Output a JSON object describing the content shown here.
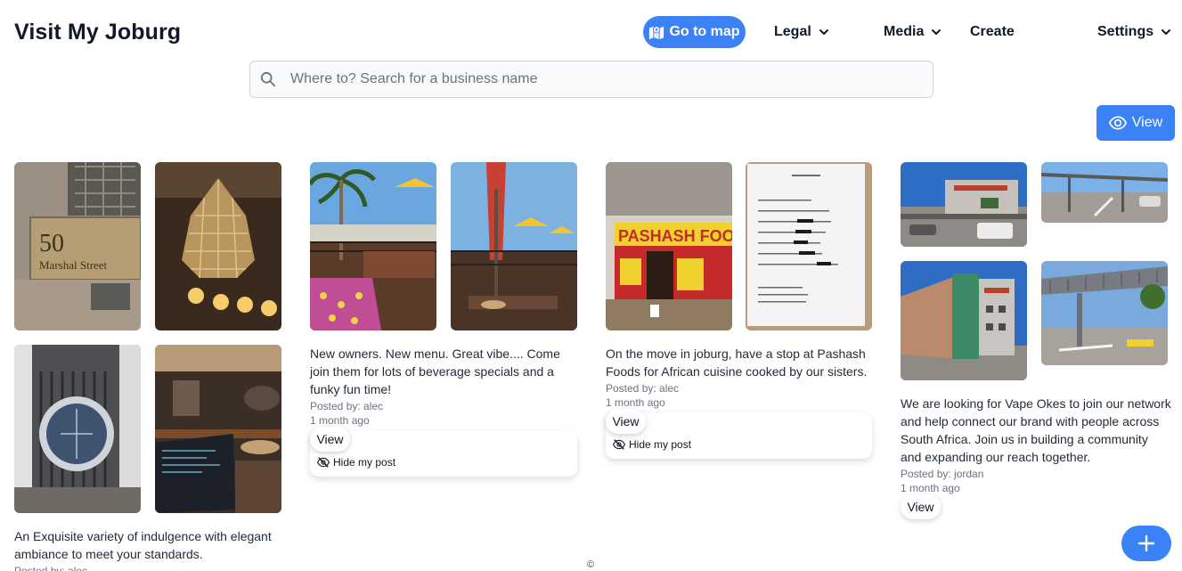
{
  "header": {
    "brand": "Visit My Joburg",
    "map_button": "Go to map",
    "nav": {
      "legal": "Legal",
      "media": "Media",
      "create": "Create",
      "settings": "Settings"
    }
  },
  "search": {
    "placeholder": "Where to? Search for a business name"
  },
  "view_button": "View",
  "posts": [
    {
      "description": "An Exquisite variety of indulgence with elegant ambiance to meet your standards.",
      "posted_by": "Posted by: alec",
      "images": [
        "50 Marshal Street plaque",
        "chandelier",
        "illuminated logo screen",
        "lounge with laptop"
      ],
      "plaque_number": "50",
      "plaque_street": "Marshal Street"
    },
    {
      "description": "New owners. New menu. Great vibe.... Come join them for lots of beverage specials and a funky fun time!",
      "posted_by": "Posted by: alec",
      "posted_when": "1 month ago",
      "view_label": "View",
      "hide_label": "Hide my post",
      "images": [
        "rooftop deck with palm tree",
        "rooftop umbrellas"
      ]
    },
    {
      "description": "On the move in joburg, have a stop at Pashash Foods for African cuisine cooked by our sisters.",
      "posted_by": "Posted by: alec",
      "posted_when": "1 month ago",
      "view_label": "View",
      "hide_label": "Hide my post",
      "images": [
        "Pashash Foods storefront",
        "printed menu on wall"
      ],
      "storefront_sign": "PASHASH FOODS"
    },
    {
      "description": "We are looking for Vape Okes to join our network and help connect our brand with people across South Africa. Join us in building a community and expanding our reach together.",
      "posted_by": "Posted by: jordan",
      "posted_when": "1 month ago",
      "view_label": "View",
      "images": [
        "shopping centre parking",
        "covered parking lot",
        "building facade",
        "pedestrian bridge"
      ]
    }
  ],
  "footer": {
    "copyright": "©"
  },
  "icons": {
    "map": "map-icon",
    "chevron": "chevron-down-icon",
    "search": "search-icon",
    "eye": "eye-icon",
    "eye_slash": "eye-slash-icon",
    "plus": "plus-icon"
  },
  "colors": {
    "accent": "#3b82f6",
    "text": "#111827",
    "muted": "#6b7280"
  }
}
